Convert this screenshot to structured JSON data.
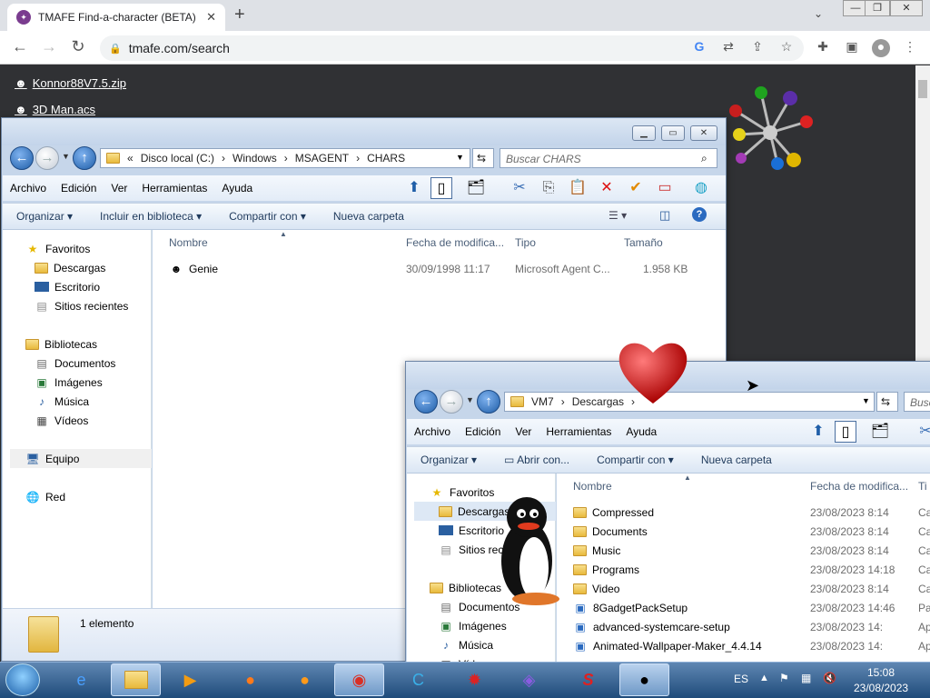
{
  "browser": {
    "tab_title": "TMAFE Find-a-character (BETA)",
    "url": "tmafe.com/search"
  },
  "web": {
    "links": [
      "Konnor88V7.5.zip",
      "3D Man.acs"
    ]
  },
  "explorer1": {
    "breadcrumb": [
      "«",
      "Disco local (C:)",
      "Windows",
      "MSAGENT",
      "CHARS"
    ],
    "search_placeholder": "Buscar CHARS",
    "menu": [
      "Archivo",
      "Edición",
      "Ver",
      "Herramientas",
      "Ayuda"
    ],
    "commands": [
      "Organizar",
      "Incluir en biblioteca",
      "Compartir con",
      "Nueva carpeta"
    ],
    "nav": {
      "favorites": "Favoritos",
      "favorites_items": [
        "Descargas",
        "Escritorio",
        "Sitios recientes"
      ],
      "libraries": "Bibliotecas",
      "libraries_items": [
        "Documentos",
        "Imágenes",
        "Música",
        "Vídeos"
      ],
      "computer": "Equipo",
      "network": "Red"
    },
    "columns": [
      "Nombre",
      "Fecha de modifica...",
      "Tipo",
      "Tamaño"
    ],
    "files": [
      {
        "name": "Genie",
        "date": "30/09/1998 11:17",
        "type": "Microsoft Agent C...",
        "size": "1.958 KB"
      }
    ],
    "status": "1 elemento"
  },
  "explorer2": {
    "breadcrumb": [
      "VM7",
      "Descargas"
    ],
    "search_placeholder": "Busc",
    "menu": [
      "Archivo",
      "Edición",
      "Ver",
      "Herramientas",
      "Ayuda"
    ],
    "commands": [
      "Organizar",
      "Abrir con...",
      "Compartir con",
      "Nueva carpeta"
    ],
    "nav": {
      "favorites": "Favoritos",
      "favorites_items": [
        "Descargas",
        "Escritorio",
        "Sitios rec"
      ],
      "libraries": "Bibliotecas",
      "libraries_items": [
        "Documentos",
        "Imágenes",
        "Música",
        "Víd"
      ]
    },
    "columns": [
      "Nombre",
      "Fecha de modifica...",
      "Ti"
    ],
    "files": [
      {
        "name": "Compressed",
        "date": "23/08/2023 8:14",
        "type": "Ca"
      },
      {
        "name": "Documents",
        "date": "23/08/2023 8:14",
        "type": "Ca"
      },
      {
        "name": "Music",
        "date": "23/08/2023 8:14",
        "type": "Ca"
      },
      {
        "name": "Programs",
        "date": "23/08/2023 14:18",
        "type": "Ca"
      },
      {
        "name": "Video",
        "date": "23/08/2023 8:14",
        "type": "Ca"
      },
      {
        "name": "8GadgetPackSetup",
        "date": "23/08/2023 14:46",
        "type": "Pa"
      },
      {
        "name": "advanced-systemcare-setup",
        "date": "23/08/2023 14:",
        "type": "Ap"
      },
      {
        "name": "Animated-Wallpaper-Maker_4.4.14",
        "date": "23/08/2023 14:",
        "type": "Ap"
      }
    ]
  },
  "taskbar": {
    "lang": "ES",
    "time": "15:08",
    "date": "23/08/2023"
  }
}
